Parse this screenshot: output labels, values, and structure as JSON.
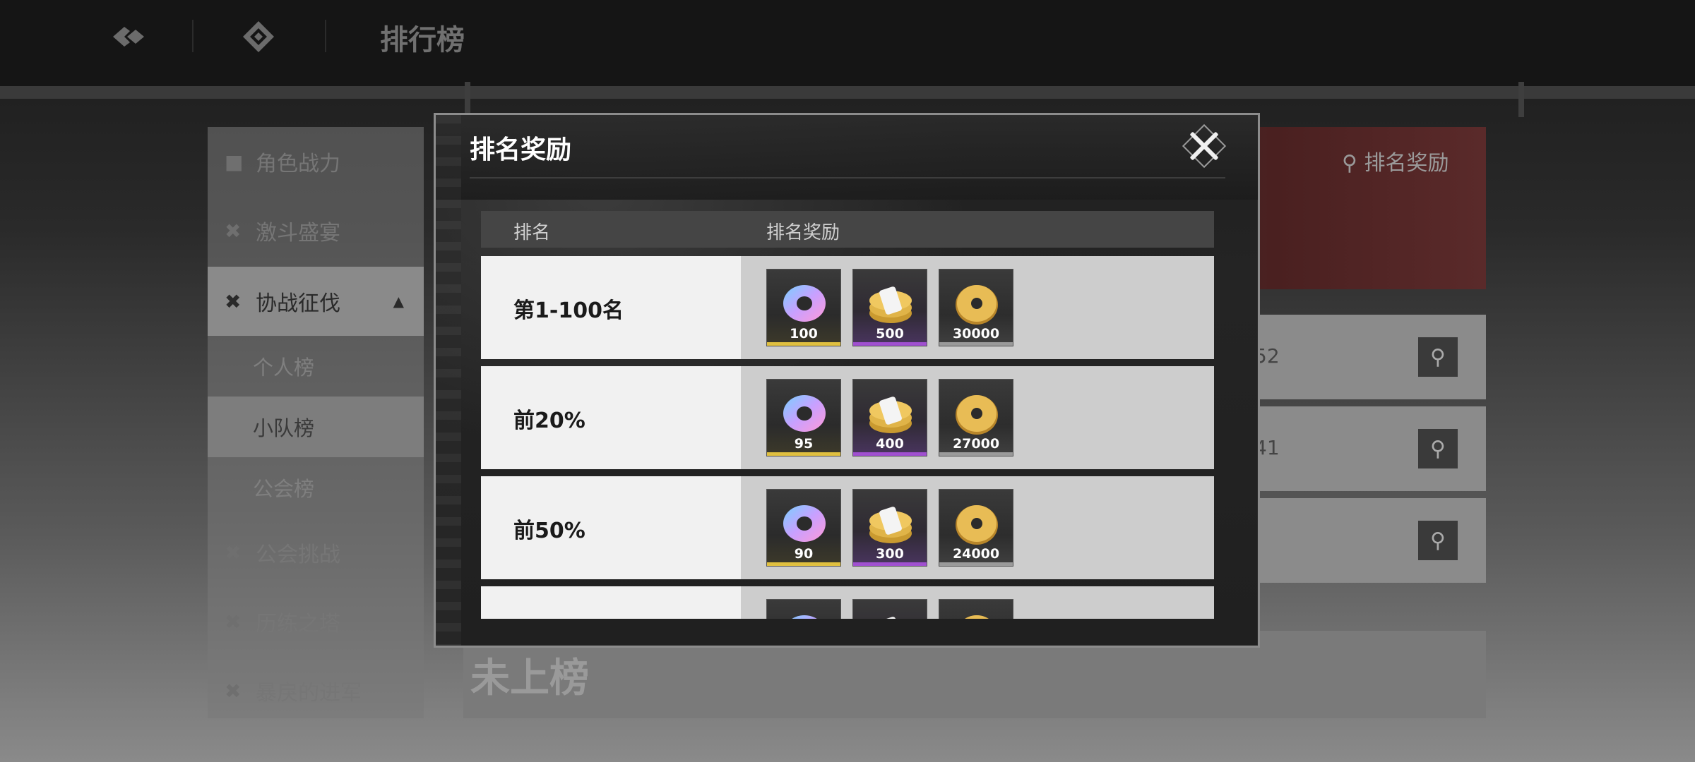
{
  "topbar": {
    "title": "排行榜",
    "icons": [
      "back-icon",
      "home-icon"
    ]
  },
  "sidebar": {
    "items": [
      {
        "label": "角色战力",
        "icon": "person-icon"
      },
      {
        "label": "激斗盛宴",
        "icon": "crossed-swords-icon"
      },
      {
        "label": "协战征伐",
        "icon": "crossed-swords-icon",
        "expanded": true
      },
      {
        "label": "公会挑战",
        "icon": "crossed-swords-icon"
      },
      {
        "label": "历练之塔",
        "icon": "crossed-swords-icon"
      },
      {
        "label": "暴戾的进军",
        "icon": "crossed-swords-icon"
      }
    ],
    "sub_items": [
      "个人榜",
      "小队榜",
      "公会榜"
    ],
    "active_sub": "小队榜"
  },
  "right_panel": {
    "search_label": "排名奖励",
    "rows": [
      {
        "value": "52"
      },
      {
        "value": "41"
      },
      {
        "value": ""
      }
    ],
    "unranked_label": "未上榜"
  },
  "modal": {
    "title": "排名奖励",
    "columns": {
      "rank": "排名",
      "rewards": "排名奖励"
    },
    "rows": [
      {
        "rank": "第1-100名",
        "rewards": [
          {
            "icon": "rainbow-ring-icon",
            "quantity": "100",
            "rarity": "gold"
          },
          {
            "icon": "coin-stack-icon",
            "quantity": "500",
            "rarity": "purple"
          },
          {
            "icon": "gold-coin-icon",
            "quantity": "30000",
            "rarity": "grey"
          }
        ]
      },
      {
        "rank": "前20%",
        "rewards": [
          {
            "icon": "rainbow-ring-icon",
            "quantity": "95",
            "rarity": "gold"
          },
          {
            "icon": "coin-stack-icon",
            "quantity": "400",
            "rarity": "purple"
          },
          {
            "icon": "gold-coin-icon",
            "quantity": "27000",
            "rarity": "grey"
          }
        ]
      },
      {
        "rank": "前50%",
        "rewards": [
          {
            "icon": "rainbow-ring-icon",
            "quantity": "90",
            "rarity": "gold"
          },
          {
            "icon": "coin-stack-icon",
            "quantity": "300",
            "rarity": "purple"
          },
          {
            "icon": "gold-coin-icon",
            "quantity": "24000",
            "rarity": "grey"
          }
        ]
      },
      {
        "rank": "",
        "rewards": [
          {
            "icon": "rainbow-ring-icon",
            "quantity": "",
            "rarity": "gold"
          },
          {
            "icon": "coin-stack-icon",
            "quantity": "",
            "rarity": "purple"
          },
          {
            "icon": "gold-coin-icon",
            "quantity": "",
            "rarity": "grey"
          }
        ]
      }
    ]
  },
  "colors": {
    "rarity_gold": "#e0c040",
    "rarity_purple": "#a050d0",
    "rarity_grey": "#9a9a9a",
    "modal_border": "#8c8c8c"
  }
}
